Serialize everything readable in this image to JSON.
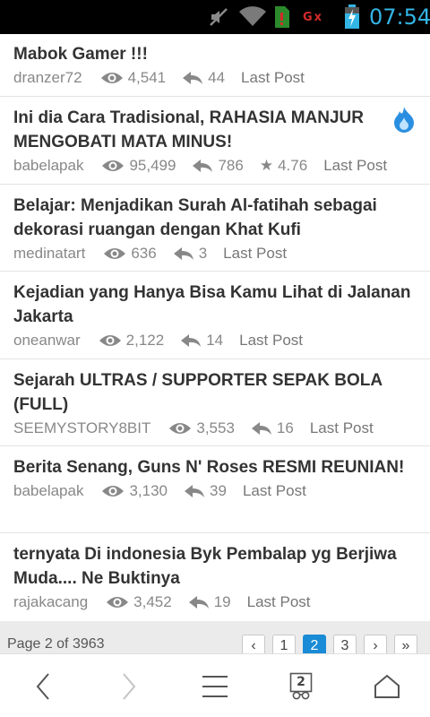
{
  "status_bar": {
    "time": "07:54",
    "carrier_g": "G",
    "carrier_x": "x",
    "icons": [
      "mute-icon",
      "wifi-icon",
      "sim-alert-icon",
      "battery-charging-icon"
    ]
  },
  "threads": [
    {
      "title": "Mabok Gamer !!!",
      "author": "dranzer72",
      "views": "4,541",
      "replies": "44",
      "rating": "",
      "last_post": "Last Post",
      "hot": false
    },
    {
      "title": "Ini dia Cara Tradisional, RAHASIA MANJUR MENGOBATI MATA MINUS!",
      "author": "babelapak",
      "views": "95,499",
      "replies": "786",
      "rating": "4.76",
      "last_post": "Last Post",
      "hot": true
    },
    {
      "title": "Belajar: Menjadikan Surah Al-fatihah sebagai dekorasi ruangan dengan Khat Kufi",
      "author": "medinatart",
      "views": "636",
      "replies": "3",
      "rating": "",
      "last_post": "Last Post",
      "hot": false
    },
    {
      "title": "Kejadian yang Hanya Bisa Kamu Lihat di Jalanan Jakarta",
      "author": "oneanwar",
      "views": "2,122",
      "replies": "14",
      "rating": "",
      "last_post": "Last Post",
      "hot": false
    },
    {
      "title": "Sejarah ULTRAS / SUPPORTER SEPAK BOLA (FULL)",
      "author": "SEEMYSTORY8BIT",
      "views": "3,553",
      "replies": "16",
      "rating": "",
      "last_post": "Last Post",
      "hot": false
    },
    {
      "title": "Berita Senang, Guns N' Roses RESMI REUNIAN!",
      "author": "babelapak",
      "views": "3,130",
      "replies": "39",
      "rating": "",
      "last_post": "Last Post",
      "hot": false
    },
    {
      "title": "ternyata Di indonesia Byk Pembalap yg Berjiwa Muda.... Ne Buktinya",
      "author": "rajakacang",
      "views": "3,452",
      "replies": "19",
      "rating": "",
      "last_post": "Last Post",
      "hot": false
    }
  ],
  "pagination": {
    "info": "Page 2 of 3963",
    "prev": "‹",
    "pages": [
      "1",
      "2",
      "3"
    ],
    "current": "2",
    "next": "›",
    "last": "»"
  },
  "toolbar": {
    "tab_count": "2",
    "icons": [
      "back-icon",
      "forward-icon",
      "menu-icon",
      "tabs-icon",
      "home-icon"
    ]
  }
}
